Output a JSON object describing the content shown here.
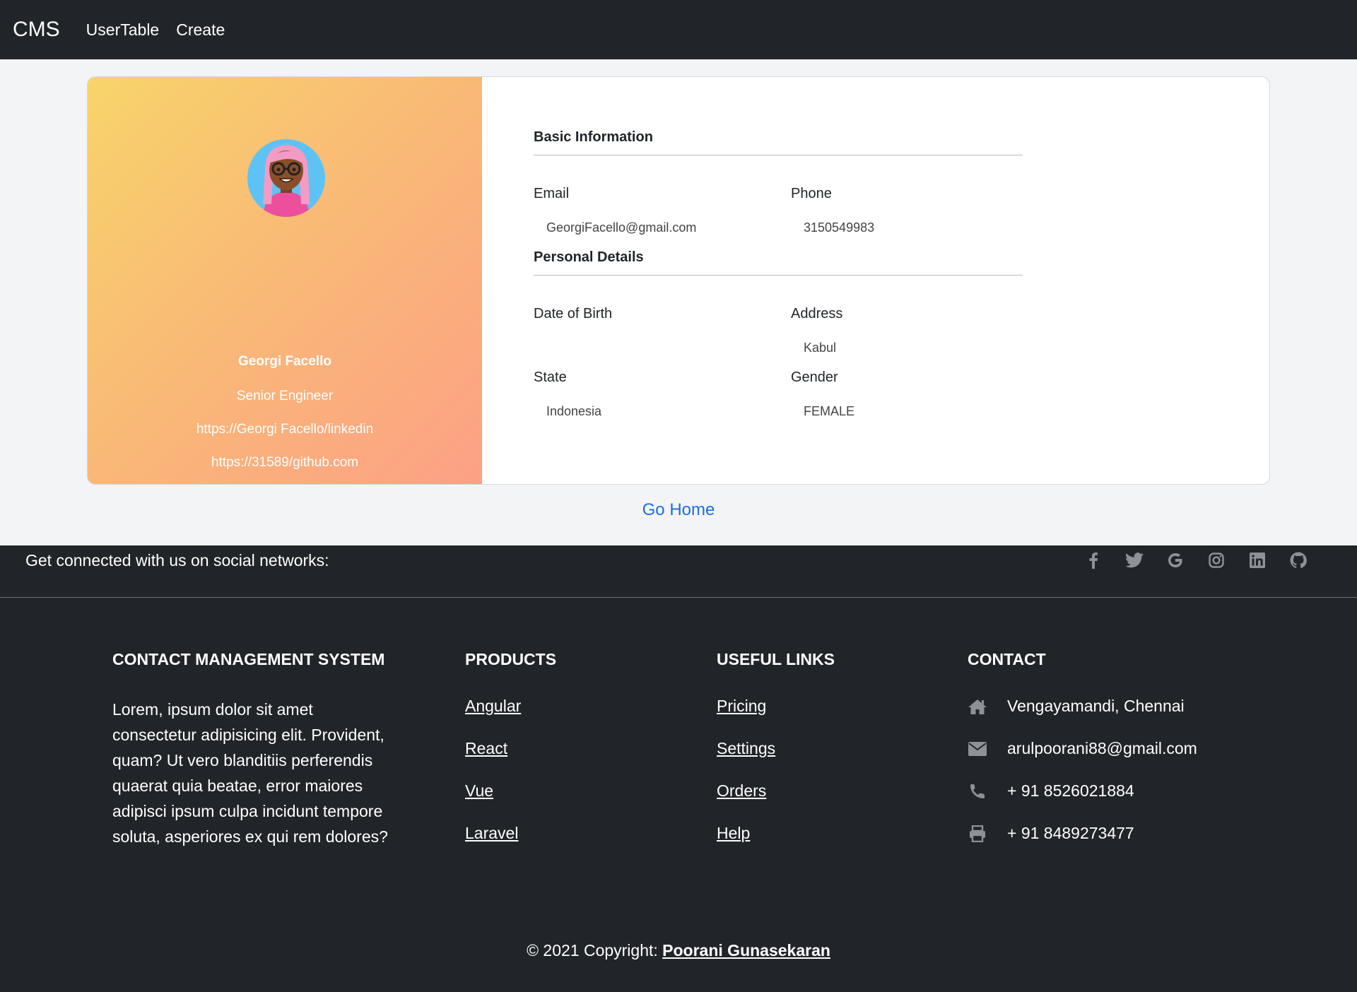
{
  "navbar": {
    "brand": "CMS",
    "links": [
      "UserTable",
      "Create"
    ]
  },
  "profile": {
    "name": "Georgi Facello",
    "title": "Senior Engineer",
    "linkedin": "https://Georgi Facello/linkedin",
    "github": "https://31589/github.com"
  },
  "basic_info": {
    "heading": "Basic Information",
    "email_label": "Email",
    "email_value": "GeorgiFacello@gmail.com",
    "phone_label": "Phone",
    "phone_value": "3150549983"
  },
  "personal_details": {
    "heading": "Personal Details",
    "dob_label": "Date of Birth",
    "dob_value": "",
    "address_label": "Address",
    "address_value": "Kabul",
    "state_label": "State",
    "state_value": "Indonesia",
    "gender_label": "Gender",
    "gender_value": "FEMALE"
  },
  "go_home": "Go Home",
  "footer": {
    "social_text": "Get connected with us on social networks:",
    "social_icons": [
      "facebook-icon",
      "twitter-icon",
      "google-icon",
      "instagram-icon",
      "linkedin-icon",
      "github-icon"
    ],
    "about_title": "CONTACT MANAGEMENT SYSTEM",
    "about_text": "Lorem, ipsum dolor sit amet consectetur adipisicing elit. Provident, quam? Ut vero blanditiis perferendis quaerat quia beatae, error maiores adipisci ipsum culpa incidunt tempore soluta, asperiores ex qui rem dolores?",
    "products_title": "PRODUCTS",
    "products": [
      "Angular",
      "React",
      "Vue",
      "Laravel"
    ],
    "links_title": "USEFUL LINKS",
    "links": [
      "Pricing",
      "Settings",
      "Orders",
      "Help"
    ],
    "contact_title": "CONTACT",
    "contact": {
      "address": "Vengayamandi, Chennai",
      "email": "arulpoorani88@gmail.com",
      "phone": "+ 91 8526021884",
      "fax": "+ 91 8489273477"
    },
    "copyright_prefix": "© 2021 Copyright:",
    "copyright_author": "Poorani Gunasekaran"
  }
}
